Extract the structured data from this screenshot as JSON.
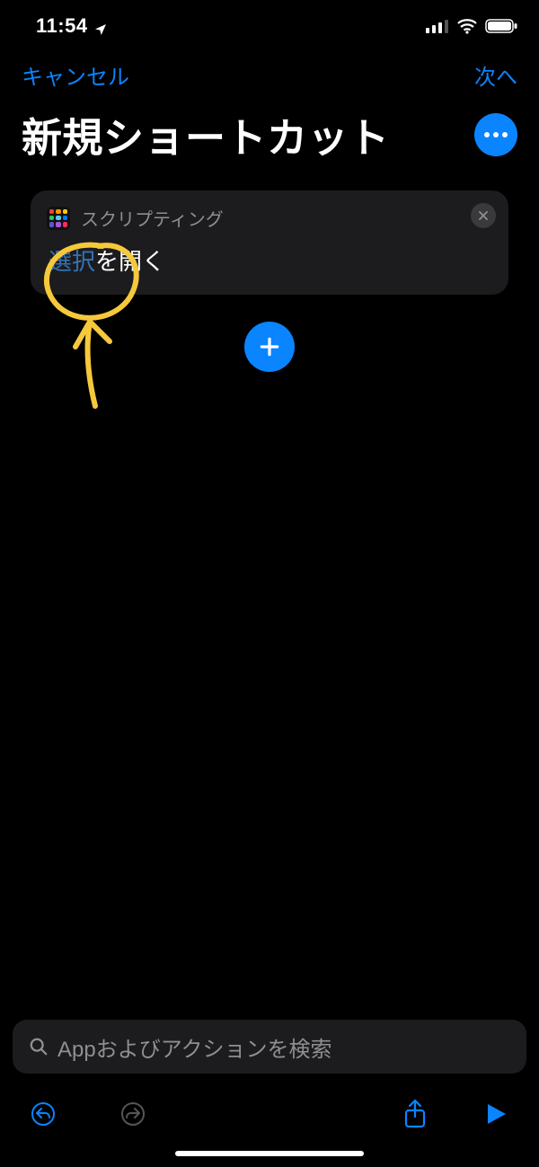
{
  "status": {
    "time": "11:54"
  },
  "nav": {
    "cancel": "キャンセル",
    "next": "次へ"
  },
  "title": "新規ショートカット",
  "action_card": {
    "category": "スクリプティング",
    "token": "選択",
    "suffix": " を開く",
    "grid_colors": [
      "#ff3b30",
      "#ff9500",
      "#ffcc00",
      "#34c759",
      "#5ac8fa",
      "#007aff",
      "#5856d6",
      "#af52de",
      "#ff2d55"
    ]
  },
  "search": {
    "placeholder": "Appおよびアクションを検索"
  },
  "colors": {
    "accent": "#0a84ff",
    "annotation": "#f5c93b"
  }
}
